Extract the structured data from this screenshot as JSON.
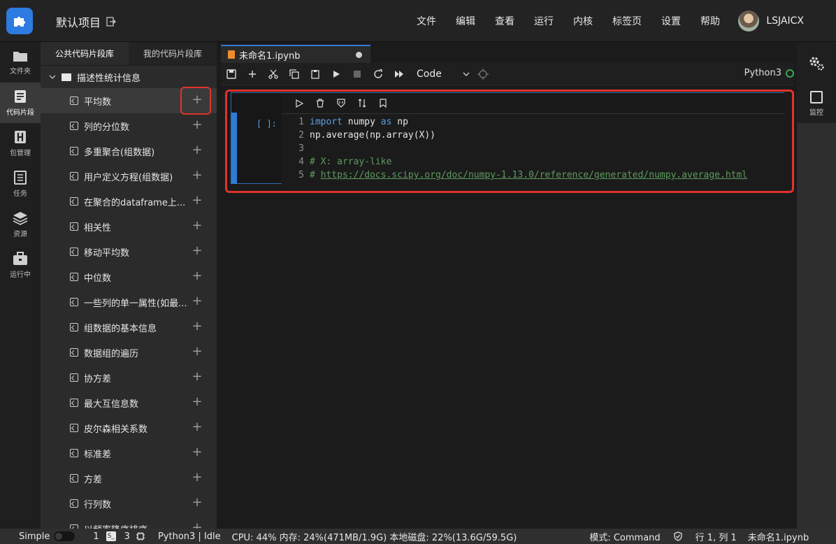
{
  "topbar": {
    "project_name": "默认项目",
    "menu": [
      "文件",
      "编辑",
      "查看",
      "运行",
      "内核",
      "标签页",
      "设置",
      "帮助"
    ],
    "username": "LSJAICX"
  },
  "rail": {
    "items": [
      {
        "label": "文件夹",
        "icon": "folder-icon"
      },
      {
        "label": "代码片段",
        "icon": "snippet-icon"
      },
      {
        "label": "包管理",
        "icon": "package-icon"
      },
      {
        "label": "任务",
        "icon": "task-icon"
      },
      {
        "label": "资源",
        "icon": "layers-icon"
      },
      {
        "label": "运行中",
        "icon": "briefcase-icon"
      }
    ]
  },
  "panel": {
    "tabs": [
      "公共代码片段库",
      "我的代码片段库"
    ],
    "folder": "描述性统计信息",
    "items": [
      "平均数",
      "列的分位数",
      "多重聚合(组数据)",
      "用户定义方程(组数据)",
      "在聚合的dataframe上...",
      "相关性",
      "移动平均数",
      "中位数",
      "一些列的单一属性(如最...",
      "组数据的基本信息",
      "数据组的遍历",
      "协方差",
      "最大互信息数",
      "皮尔森相关系数",
      "标准差",
      "方差",
      "行列数",
      "以频率降序排序"
    ]
  },
  "notebook": {
    "tab_name": "未命名1.ipynb",
    "cell_type": "Code",
    "kernel_name": "Python3",
    "prompt": "[ ]:",
    "code_lines": [
      {
        "n": "1"
      },
      {
        "n": "2",
        "text": "np.average(np.array(X))"
      },
      {
        "n": "3",
        "text": ""
      },
      {
        "n": "4",
        "text": "# X: array-like"
      },
      {
        "n": "5",
        "prefix": "# ",
        "url": "https://docs.scipy.org/doc/numpy-1.13.0/reference/generated/numpy.average.html"
      }
    ],
    "line1": {
      "kw1": "import",
      "mod": "numpy",
      "kw2": "as",
      "alias": "np"
    }
  },
  "right_rail": {
    "monitor_label": "监控"
  },
  "statusbar": {
    "mode_simple": "Simple",
    "count1": "1",
    "term_label": "S_",
    "count2": "3",
    "kernel_status": "Python3 | Idle",
    "resources": "CPU:  44% 内存:  24%(471MB/1.9G) 本地磁盘:  22%(13.6G/59.5G)",
    "mode": "模式:  Command",
    "position": "行 1, 列 1",
    "file": "未命名1.ipynb"
  }
}
